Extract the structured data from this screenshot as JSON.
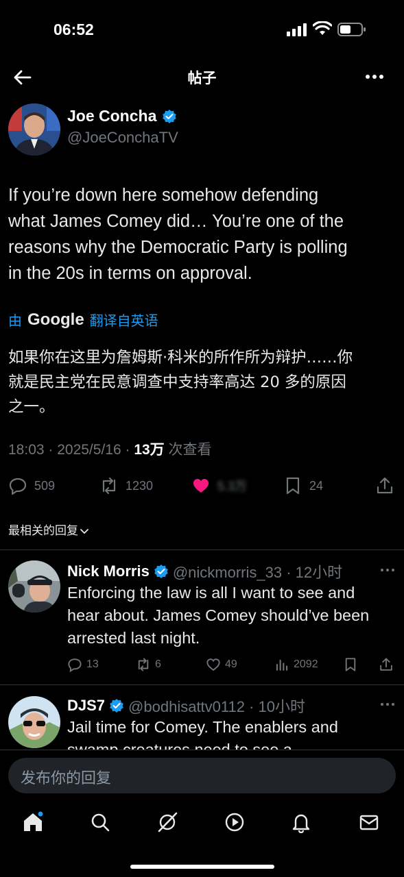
{
  "status_bar": {
    "time": "06:52"
  },
  "header": {
    "title": "帖子"
  },
  "tweet": {
    "author_name": "Joe Concha",
    "author_handle": "@JoeConchaTV",
    "text_lines": [
      "If you’re down here somehow defending",
      "what James Comey did… You’re one of the",
      "reasons why the Democratic Party is polling",
      "in the 20s in terms on approval."
    ],
    "translate_prefix": "由",
    "translate_brand": "Google",
    "translate_suffix": "翻译自英语",
    "translation_lines": [
      "如果你在这里为詹姆斯·科米的所作所为辩护……你",
      "就是民主党在民意调查中支持率高达 20 多的原因",
      "之一。"
    ],
    "meta_time": "18:03 · 2025/5/16 · ",
    "meta_views": "13万",
    "meta_views_label": " 次查看",
    "stats": {
      "replies": "509",
      "retweets": "1230",
      "likes": "5.3万",
      "bookmarks": "24"
    },
    "like_color": "#f91880"
  },
  "sort_label": "最相关的回复",
  "replies": [
    {
      "name": "Nick Morris",
      "handle_time": "@nickmorris_33 · 12小时",
      "lines": [
        "Enforcing the law is all I want to see and",
        "hear about. James Comey should’ve been",
        "arrested last night."
      ],
      "stats": {
        "replies": "13",
        "retweets": "6",
        "likes": "49",
        "views": "2092"
      }
    },
    {
      "name": "DJS7",
      "handle_time": "@bodhisattv0112 · 10小时",
      "lines": [
        "Jail time for Comey. The enablers and",
        "swamp creatures need to see a"
      ]
    }
  ],
  "composer": {
    "placeholder": "发布你的回复"
  },
  "colors": {
    "accent": "#1d9bf0",
    "background": "#000000",
    "muted": "#71767b"
  }
}
